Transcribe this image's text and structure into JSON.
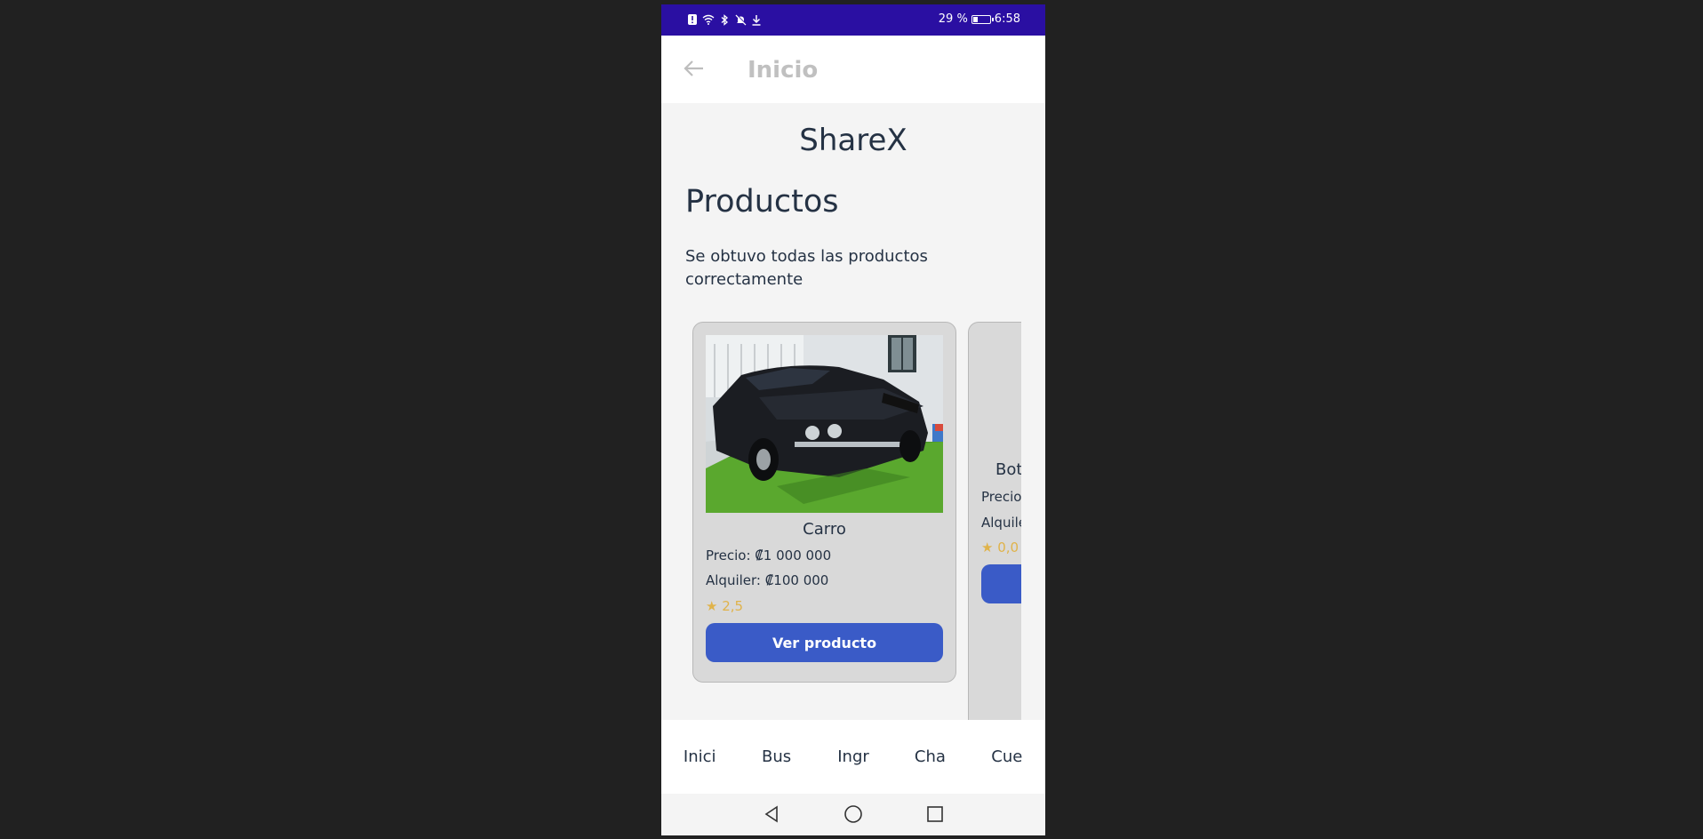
{
  "status_bar": {
    "battery": "29 %",
    "battery_level": 0.29,
    "time": "6:58",
    "icons": [
      "alert-icon",
      "wifi-icon",
      "bluetooth-icon",
      "mute-icon",
      "download-icon"
    ]
  },
  "header": {
    "back_icon": "arrow-left-icon",
    "title": "Inicio"
  },
  "main": {
    "app_name": "ShareX",
    "section_title": "Productos",
    "status_message": "Se obtuvo todas las productos correctamente"
  },
  "products": [
    {
      "name": "Carro",
      "price": "Precio: ₡1 000 000",
      "rent": "Alquiler: ₡100 000",
      "rating": "★ 2,5",
      "button": "Ver producto"
    },
    {
      "name": "Bot",
      "price": "Precio",
      "rent": "Alquile",
      "rating": "★ 0,0"
    }
  ],
  "tabs": [
    {
      "label": "Inici"
    },
    {
      "label": "Bus"
    },
    {
      "label": "Ingr"
    },
    {
      "label": "Cha"
    },
    {
      "label": "Cue"
    }
  ],
  "nav": [
    "back-triangle-icon",
    "home-circle-icon",
    "recents-square-icon"
  ],
  "colors": {
    "status_bar": "#2a0fa2",
    "accent": "#3a5bc7",
    "rating": "#e0b34a",
    "text": "#253244"
  }
}
